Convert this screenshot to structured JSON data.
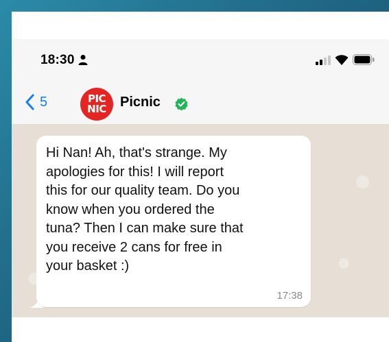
{
  "status_bar": {
    "time": "18:30",
    "icons": [
      "person-icon",
      "signal-icon",
      "wifi-icon",
      "battery-icon"
    ]
  },
  "header": {
    "back_count": "5",
    "avatar": {
      "line1": "PIC",
      "line2": "NIC"
    },
    "contact_name": "Picnic",
    "verified_icon": "verified-check-icon"
  },
  "message": {
    "lines": [
      "Hi Nan! Ah, that's strange. My",
      "apologies for this! I will report",
      "this for our quality team. Do you",
      "know when you ordered the",
      "tuna? Then I can make sure that",
      "you receive 2 cans for free in",
      "your basket :)"
    ],
    "time": "17:38"
  },
  "colors": {
    "background": "#226e8c",
    "chat_background": "#e7dfd5",
    "accent_blue": "#1a7cf5",
    "avatar_red": "#e32624",
    "verified_green": "#25b35a"
  }
}
